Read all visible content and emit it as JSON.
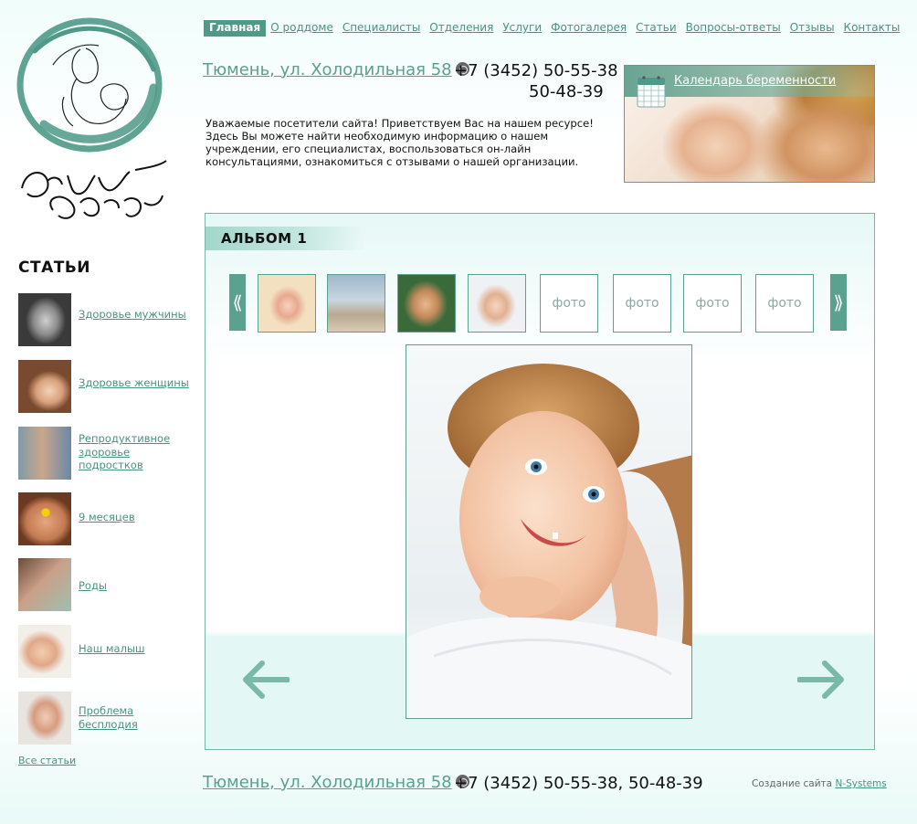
{
  "nav": {
    "items": [
      {
        "label": "Главная",
        "active": true
      },
      {
        "label": "О роддоме"
      },
      {
        "label": "Специалисты"
      },
      {
        "label": "Отделения"
      },
      {
        "label": "Услуги"
      },
      {
        "label": "Фотогалерея"
      },
      {
        "label": "Статьи"
      },
      {
        "label": "Вопросы-ответы"
      },
      {
        "label": "Отзывы"
      },
      {
        "label": "Контакты"
      }
    ]
  },
  "header": {
    "address": "Тюмень, ул. Холодильная 58",
    "phone_main": "+7 (3452) 50-55-38",
    "phone_second": "50-48-39",
    "welcome": "Уважаемые посетители сайта! Приветствуем Вас на нашем ресурсе! Здесь Вы можете найти необходимую информацию о нашем учреждении, его специалистах, воспользоваться он-лайн консультациями, ознакомиться с отзывами о нашей организации."
  },
  "banner": {
    "link": "Календарь беременности",
    "icon": "calendar-icon"
  },
  "sidebar": {
    "title": "СТАТЬИ",
    "articles": [
      {
        "label": "Здоровье мужчины"
      },
      {
        "label": "Здоровье женщины"
      },
      {
        "label": "Репродуктивное здоровье подростков"
      },
      {
        "label": "9 месяцев"
      },
      {
        "label": "Роды"
      },
      {
        "label": "Наш малыш"
      },
      {
        "label": "Проблема бесплодия"
      }
    ],
    "all_link": "Все статьи"
  },
  "album": {
    "title": "АЛЬБОМ 1",
    "prev_strip": "⟪",
    "next_strip": "⟫",
    "placeholders": [
      "фото",
      "фото",
      "фото",
      "фото"
    ],
    "prev_icon": "arrow-left-icon",
    "next_icon": "arrow-right-icon"
  },
  "footer": {
    "address": "Тюмень, ул. Холодильная 58",
    "phones": "+7 (3452) 50-55-38, 50-48-39",
    "credit_prefix": "Создание сайта",
    "credit_link": "N-Systems"
  },
  "colors": {
    "accent": "#4e9987",
    "link": "#4a9383",
    "border": "#5aa18f"
  }
}
